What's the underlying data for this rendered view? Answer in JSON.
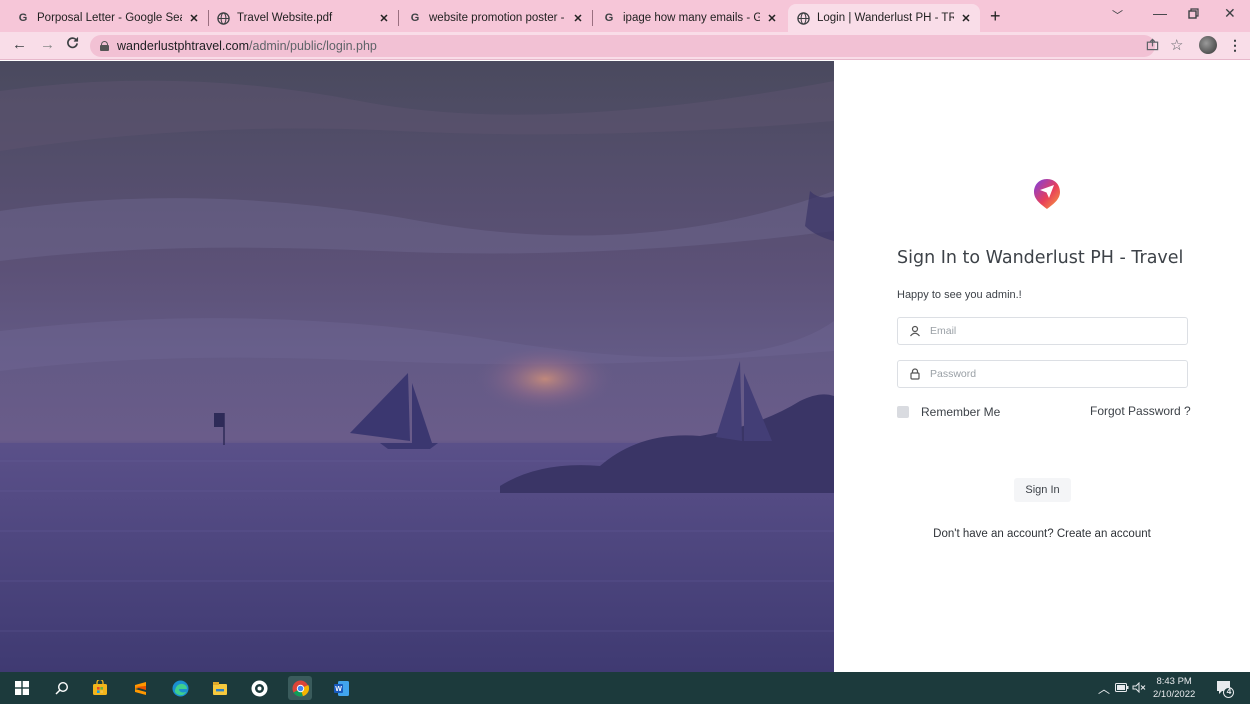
{
  "browser": {
    "tabs": [
      {
        "title": "Porposal Letter - Google Search",
        "favicon": "google-g-icon"
      },
      {
        "title": "Travel Website.pdf",
        "favicon": "globe-icon"
      },
      {
        "title": "website promotion poster - Goo",
        "favicon": "google-g-icon"
      },
      {
        "title": "ipage how many emails - Google",
        "favicon": "google-g-icon"
      },
      {
        "title": "Login | Wanderlust PH - TRavel D",
        "favicon": "globe-icon",
        "active": true
      }
    ],
    "new_tab": "+",
    "url_host": "wanderlustphtravel.com",
    "url_path": "/admin/public/login.php"
  },
  "login": {
    "title": "Sign In to Wanderlust PH - Travel",
    "greeting": "Happy to see you admin.!",
    "email_placeholder": "Email",
    "password_placeholder": "Password",
    "remember_label": "Remember Me",
    "forgot_label": "Forgot Password ?",
    "signin_label": "Sign In",
    "create_account_text": "Don't have an account? Create an account",
    "brand_colors": [
      "#7b3fe4",
      "#e8405a",
      "#f7a33c"
    ]
  },
  "taskbar": {
    "time": "8:43 PM",
    "date": "2/10/2022",
    "notification_count": "4",
    "apps": [
      "windows-start-icon",
      "search-icon",
      "microsoft-store-icon",
      "sublime-text-icon",
      "edge-icon",
      "file-explorer-icon",
      "app-icon",
      "chrome-icon",
      "word-icon"
    ]
  },
  "theme": {
    "tabstrip_bg": "#f6c6d8",
    "taskbar_bg": "#1c3a3c",
    "hero_tint": "#5a4f86"
  }
}
